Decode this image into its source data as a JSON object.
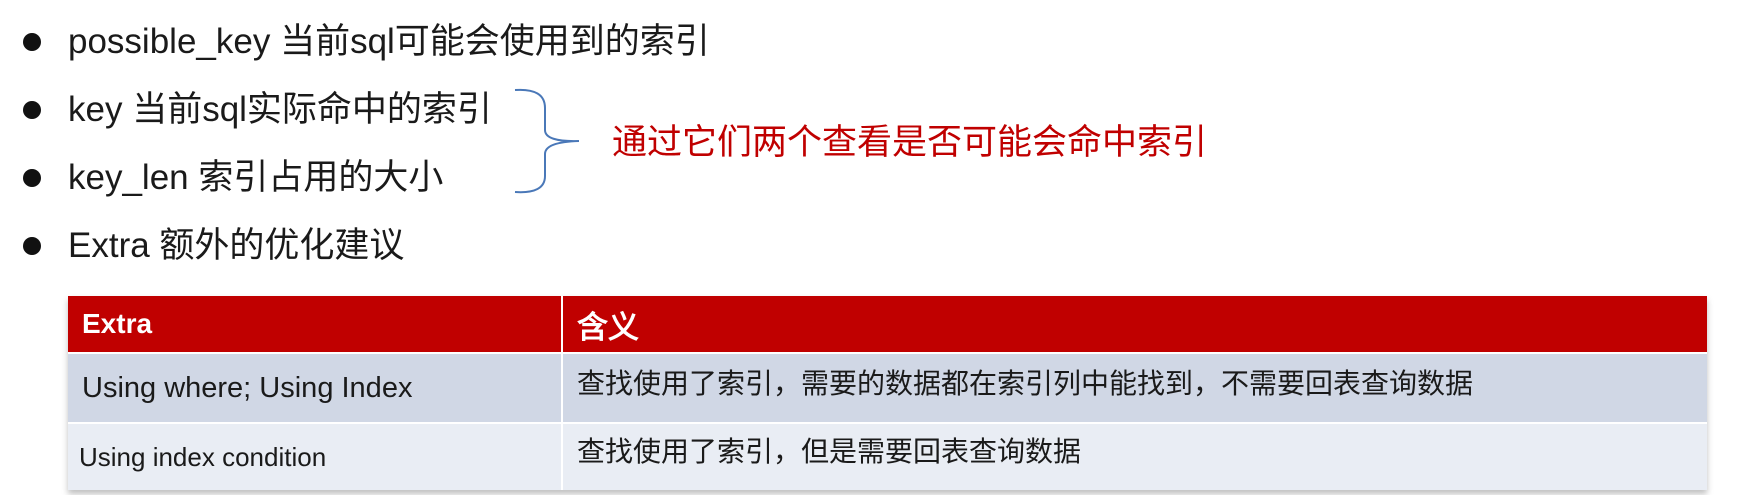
{
  "bullets": [
    {
      "text": "possible_key  当前sql可能会使用到的索引"
    },
    {
      "text": "key 当前sql实际命中的索引"
    },
    {
      "text": "key_len 索引占用的大小"
    },
    {
      "text": "Extra 额外的优化建议"
    }
  ],
  "brace_note": "通过它们两个查看是否可能会命中索引",
  "table": {
    "headers": [
      "Extra",
      "含义"
    ],
    "rows": [
      [
        "Using where; Using Index",
        "查找使用了索引，需要的数据都在索引列中能找到，不需要回表查询数据"
      ],
      [
        "Using index condition",
        "查找使用了索引，但是需要回表查询数据"
      ]
    ]
  },
  "colors": {
    "header_bg": "#c00000",
    "note_text": "#c00000",
    "brace": "#4a78b8",
    "row_1_bg": "#d0d7e5",
    "row_2_bg": "#e9edf4"
  }
}
